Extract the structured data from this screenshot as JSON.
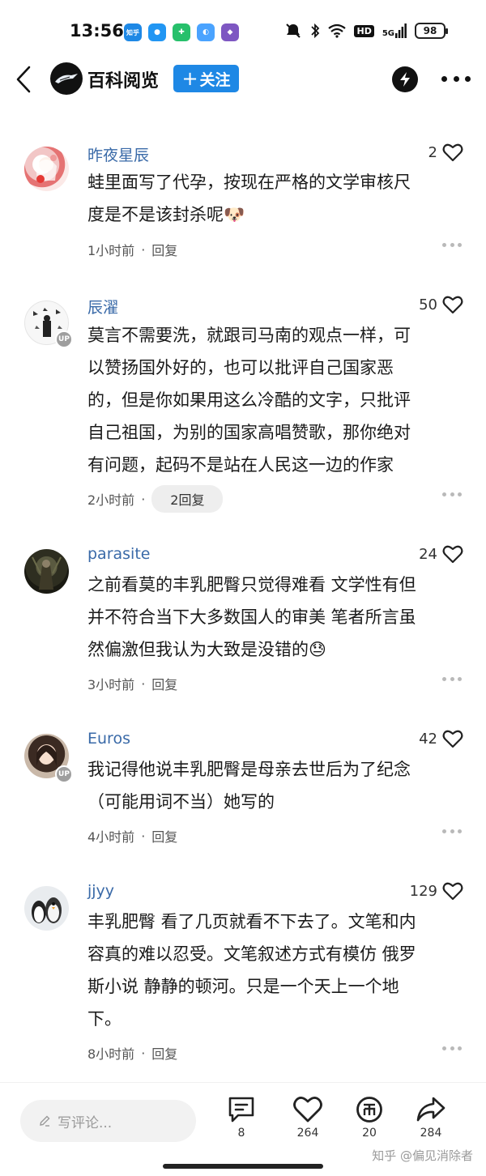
{
  "status_bar": {
    "time": "13:56",
    "app_icons": [
      {
        "name": "zhihu-notification-icon",
        "glyph": "知乎",
        "color": "#1e88e5"
      },
      {
        "name": "app-notification-icon-2",
        "glyph": "●",
        "color": "#2196f3"
      },
      {
        "name": "app-notification-icon-3",
        "glyph": "✚",
        "color": "#27c06b"
      },
      {
        "name": "app-notification-icon-4",
        "glyph": "◐",
        "color": "#4aa3ff"
      },
      {
        "name": "app-notification-icon-5",
        "glyph": "◆",
        "color": "#7e57c2"
      }
    ],
    "network": "5G",
    "hd_label": "HD",
    "battery": "98"
  },
  "header": {
    "channel_name": "百科阅览",
    "follow_label": "关注"
  },
  "comments": [
    {
      "username": "昨夜星辰",
      "likes": "2",
      "lines": [
        "蛙里面写了代孕，按现在严格的文学审核尺",
        "度是不是该封杀呢🐶"
      ],
      "time": "1小时前",
      "reply_label": "回复",
      "is_up": false
    },
    {
      "username": "辰濯",
      "likes": "50",
      "lines": [
        "莫言不需要洗，就跟司马南的观点一样，可",
        "以赞扬国外好的，也可以批评自己国家恶",
        "的，但是你如果用这么冷酷的文字，只批评",
        "自己祖国，为别的国家高唱赞歌，那你绝对",
        "有问题，起码不是站在人民这一边的作家"
      ],
      "time": "2小时前",
      "reply_label": "2回复",
      "is_up": true
    },
    {
      "username": "parasite",
      "likes": "24",
      "lines": [
        "之前看莫的丰乳肥臀只觉得难看 文学性有但",
        "并不符合当下大多数国人的审美 笔者所言虽",
        "然偏激但我认为大致是没错的😓"
      ],
      "time": "3小时前",
      "reply_label": "回复",
      "is_up": false
    },
    {
      "username": "Euros",
      "likes": "42",
      "lines": [
        "我记得他说丰乳肥臀是母亲去世后为了纪念",
        "（可能用词不当）她写的"
      ],
      "time": "4小时前",
      "reply_label": "回复",
      "is_up": true
    },
    {
      "username": "jjyy",
      "likes": "129",
      "lines": [
        "丰乳肥臀 看了几页就看不下去了。文笔和内",
        "容真的难以忍受。文笔叙述方式有模仿 俄罗",
        "斯小说 静静的顿河。只是一个天上一个地",
        "下。"
      ],
      "time": "8小时前",
      "reply_label": "回复",
      "is_up": false
    }
  ],
  "up_badge": "UP",
  "bottom_bar": {
    "input_placeholder": "写评论...",
    "comments_count": "8",
    "likes_count": "264",
    "coins_count": "20",
    "shares_count": "284",
    "watermark": "知乎 @偏见消除者"
  }
}
